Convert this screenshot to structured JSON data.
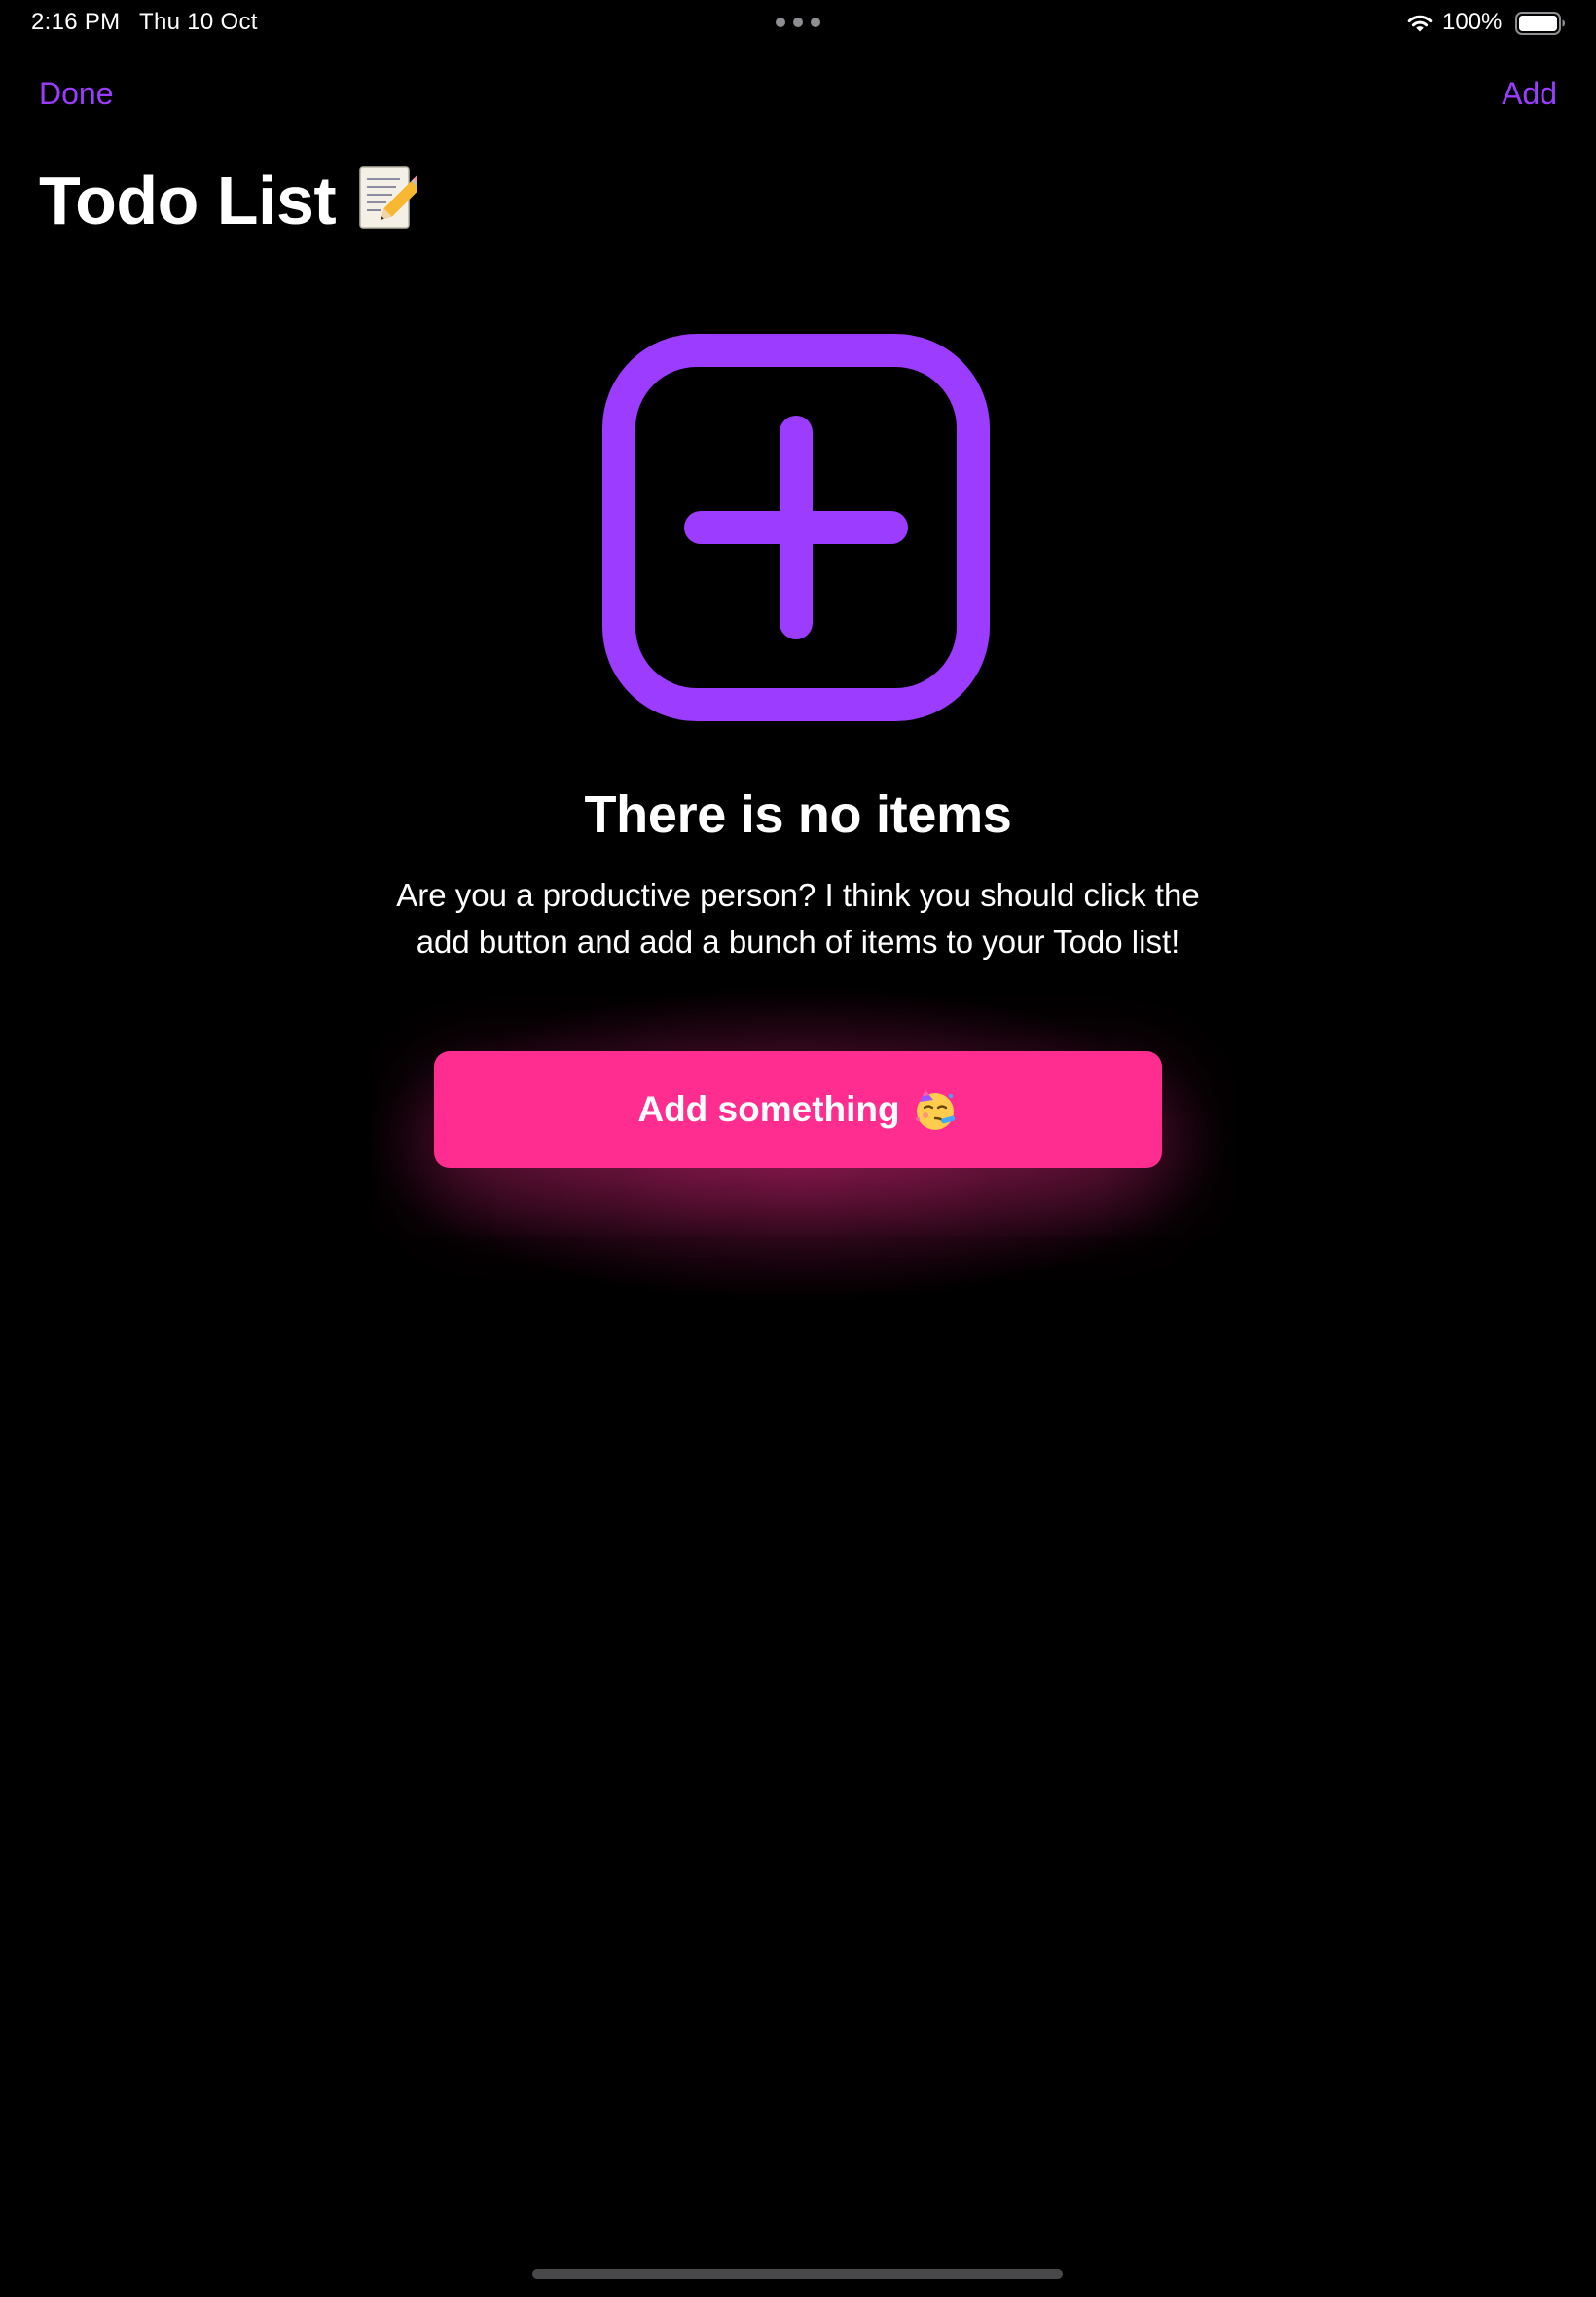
{
  "status_bar": {
    "time": "2:16 PM",
    "date": "Thu 10 Oct",
    "battery": "100%",
    "wifi_icon": "wifi-icon",
    "battery_icon": "battery-icon"
  },
  "nav": {
    "left_button": "Done",
    "right_button": "Add",
    "title": "Todo List",
    "title_icon": "memo-emoji"
  },
  "empty_state": {
    "icon": "plus-square-icon",
    "title": "There is no items",
    "description": "Are you a productive person? I think you should click the add button and add a bunch of items to your Todo list!",
    "button_label": "Add something",
    "button_icon": "partying-face-emoji"
  },
  "colors": {
    "background": "#000000",
    "accent": "#9b3cff",
    "button": "#ff2d8f",
    "text": "#ffffff"
  }
}
